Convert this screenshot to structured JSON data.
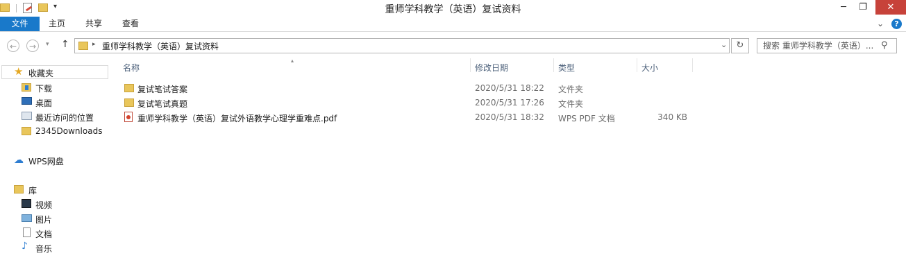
{
  "window": {
    "title": "重师学科教学（英语）复试资料"
  },
  "ribbon": {
    "tabs": [
      "文件",
      "主页",
      "共享",
      "查看"
    ]
  },
  "address": {
    "path_label": "重师学科教学（英语）复试资料"
  },
  "search": {
    "placeholder": "搜索 重师学科教学（英语）..."
  },
  "nav": {
    "favorites_label": "收藏夹",
    "favorites": [
      "下载",
      "桌面",
      "最近访问的位置",
      "2345Downloads"
    ],
    "cloud_label": "WPS网盘",
    "library_label": "库",
    "library": [
      "视频",
      "图片",
      "文档",
      "音乐"
    ]
  },
  "columns": [
    "名称",
    "修改日期",
    "类型",
    "大小"
  ],
  "files": [
    {
      "name": "复试笔试答案",
      "date": "2020/5/31 18:22",
      "type": "文件夹",
      "size": "",
      "icon": "folder-icon"
    },
    {
      "name": "复试笔试真题",
      "date": "2020/5/31 17:26",
      "type": "文件夹",
      "size": "",
      "icon": "folder-icon"
    },
    {
      "name": "重师学科教学（英语）复试外语教学心理学重难点.pdf",
      "date": "2020/5/31 18:32",
      "type": "WPS PDF 文档",
      "size": "340 KB",
      "icon": "pdf-icon"
    }
  ],
  "colors": {
    "accent": "#1979ca",
    "close": "#c7423a",
    "header_text": "#4c607a"
  }
}
